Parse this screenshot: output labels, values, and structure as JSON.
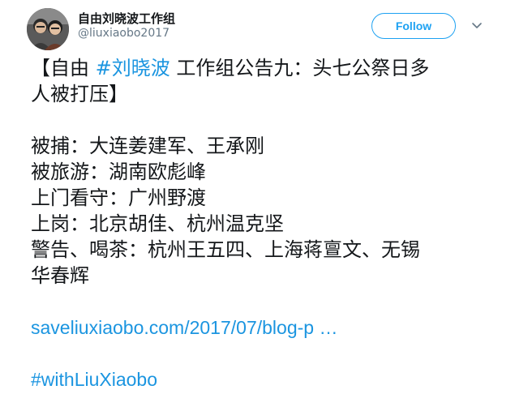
{
  "author": {
    "display_name": "自由刘晓波工作组",
    "handle": "@liuxiaobo2017"
  },
  "actions": {
    "follow_label": "Follow",
    "caret_icon": "chevron-down-icon"
  },
  "tweet": {
    "title_prefix": "【自由 ",
    "title_hashtag": "#刘晓波",
    "title_suffix": " 工作组公告九：头七公祭日多",
    "title_line2": "人被打压】",
    "lines": [
      "被捕：大连姜建军、王承刚",
      "被旅游：湖南欧彪峰",
      "上门看守：广州野渡",
      "上岗：北京胡佳、杭州温克坚",
      "警告、喝茶：杭州王五四、上海蒋亶文、无锡",
      "华春辉"
    ],
    "link_text": "saveliuxiaobo.com/2017/07/blog-p …",
    "hashtag_footer": "#withLiuXiaobo"
  },
  "colors": {
    "accent": "#1da1f2",
    "link": "#1b95e0",
    "text": "#14171a",
    "muted": "#657786"
  }
}
